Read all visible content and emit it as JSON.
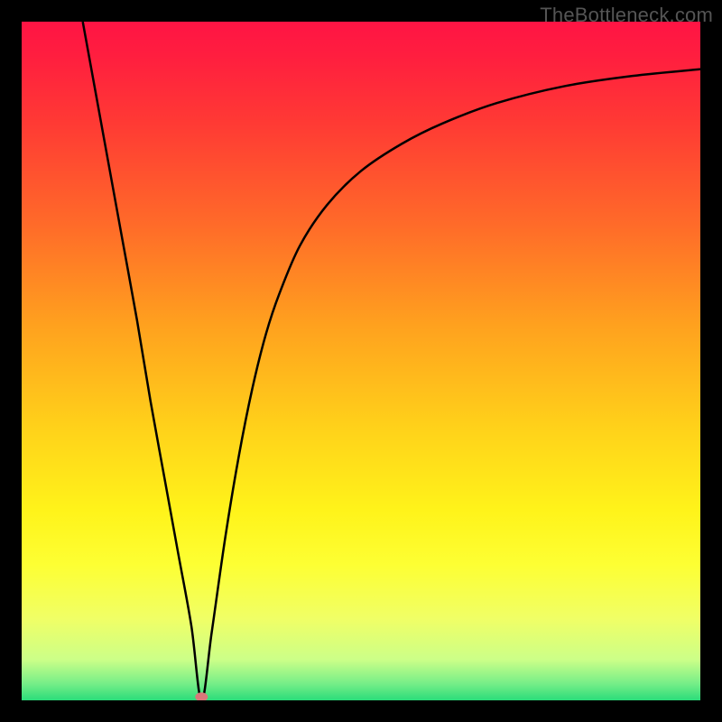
{
  "watermark_text": "TheBottleneck.com",
  "chart_data": {
    "type": "line",
    "title": "",
    "xlabel": "",
    "ylabel": "",
    "xlim": [
      0,
      100
    ],
    "ylim": [
      0,
      100
    ],
    "grid": false,
    "legend": false,
    "background_gradient_stops": [
      {
        "offset": 0.0,
        "color": "#ff1444"
      },
      {
        "offset": 0.05,
        "color": "#ff1e3f"
      },
      {
        "offset": 0.15,
        "color": "#ff3a34"
      },
      {
        "offset": 0.3,
        "color": "#ff6b29"
      },
      {
        "offset": 0.45,
        "color": "#ffa21e"
      },
      {
        "offset": 0.6,
        "color": "#ffd21a"
      },
      {
        "offset": 0.72,
        "color": "#fff31a"
      },
      {
        "offset": 0.8,
        "color": "#fdff33"
      },
      {
        "offset": 0.88,
        "color": "#f0ff66"
      },
      {
        "offset": 0.94,
        "color": "#ccff88"
      },
      {
        "offset": 0.975,
        "color": "#77ee88"
      },
      {
        "offset": 1.0,
        "color": "#2bdc7a"
      }
    ],
    "series": [
      {
        "name": "bottleneck-curve",
        "x": [
          9,
          11,
          13,
          15,
          17,
          19,
          21,
          23,
          25,
          26.5,
          28,
          30,
          32,
          34,
          36,
          38,
          41,
          45,
          50,
          56,
          62,
          70,
          80,
          90,
          100
        ],
        "y": [
          100,
          89,
          78,
          67,
          56,
          44,
          33,
          22,
          11,
          0,
          10,
          24,
          36,
          46,
          54,
          60,
          67,
          73,
          78,
          82,
          85,
          88,
          90.5,
          92,
          93
        ],
        "color": "#000000",
        "stroke_width": 2.5
      }
    ],
    "marker": {
      "name": "optimal-point",
      "x": 26.5,
      "y": 0.5,
      "rx": 7,
      "ry": 5,
      "fill": "#d9777a"
    }
  }
}
